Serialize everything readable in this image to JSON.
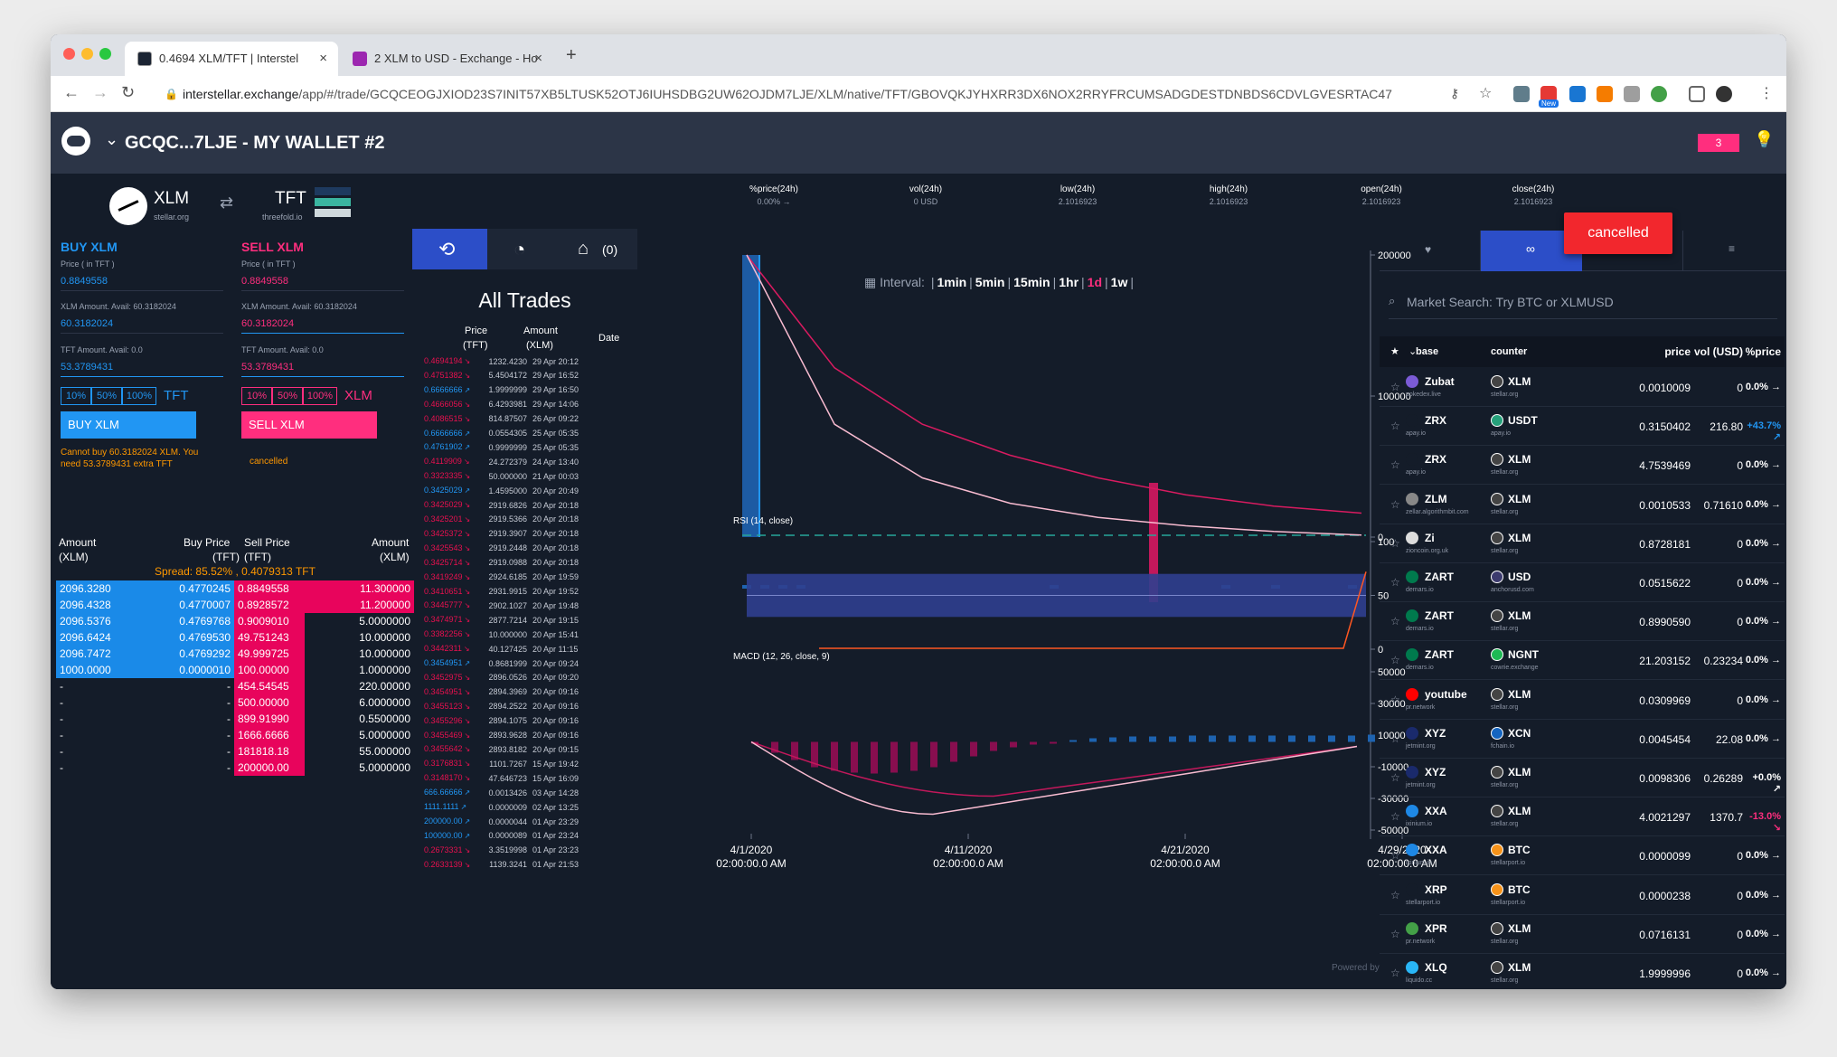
{
  "browser": {
    "tabs": [
      {
        "title": "0.4694 XLM/TFT | Interstel"
      },
      {
        "title": "2 XLM to USD - Exchange - Ho"
      }
    ],
    "url_host": "interstellar.exchange",
    "url_path": "/app/#/trade/GCQCEOGJXIOD23S7INIT57XB5LTUSK52OTJ6IUHSDBG2UW62OJDM7LJE/XLM/native/TFT/GBOVQKJYHXRR3DX6NOX2RRYFRCUMSADGDESTDNBDS6CDVLGVESRTAC47",
    "ext_badge": "New"
  },
  "header": {
    "wallet": "GCQC...7LJE - MY WALLET #2",
    "notif_count": "3"
  },
  "pair": {
    "base": "XLM",
    "base_domain": "stellar.org",
    "counter": "TFT",
    "counter_domain": "threefold.io",
    "swap_icon": "swap-arrows-icon"
  },
  "stats": [
    {
      "label": "%price(24h)",
      "value": "0.00% →"
    },
    {
      "label": "vol(24h)",
      "value": "0 USD"
    },
    {
      "label": "low(24h)",
      "value": "2.1016923"
    },
    {
      "label": "high(24h)",
      "value": "2.1016923"
    },
    {
      "label": "open(24h)",
      "value": "2.1016923"
    },
    {
      "label": "close(24h)",
      "value": "2.1016923"
    }
  ],
  "buy": {
    "title": "BUY XLM",
    "price_label": "Price ( in TFT )",
    "price": "0.8849558",
    "amount_label": "XLM Amount. Avail: 60.3182024",
    "amount": "60.3182024",
    "total_label": "TFT Amount. Avail: 0.0",
    "total": "53.3789431",
    "pcts": [
      "10%",
      "50%",
      "100%"
    ],
    "pct_unit": "TFT",
    "button": "BUY XLM",
    "error": "Cannot buy 60.3182024 XLM. You need 53.3789431 extra TFT"
  },
  "sell": {
    "title": "SELL XLM",
    "price_label": "Price ( in TFT )",
    "price": "0.8849558",
    "amount_label": "XLM Amount. Avail: 60.3182024",
    "amount": "60.3182024",
    "total_label": "TFT Amount. Avail: 0.0",
    "total": "53.3789431",
    "pcts": [
      "10%",
      "50%",
      "100%"
    ],
    "pct_unit": "XLM",
    "button": "SELL XLM",
    "status": "cancelled"
  },
  "orderbook": {
    "headers": {
      "amount_left": "Amount",
      "amount_left_unit": "(XLM)",
      "buy_price": "Buy Price",
      "buy_price_unit": "(TFT)",
      "sell_price": "Sell Price",
      "sell_price_unit": "(TFT)",
      "amount_right": "Amount",
      "amount_right_unit": "(XLM)"
    },
    "spread": "Spread: 85.52% , 0.4079313 TFT",
    "rows": [
      {
        "ba": "2096.3280",
        "bp": "0.4770245",
        "sp": "0.8849558",
        "sa": "11.300000"
      },
      {
        "ba": "2096.4328",
        "bp": "0.4770007",
        "sp": "0.8928572",
        "sa": "11.200000"
      },
      {
        "ba": "2096.5376",
        "bp": "0.4769768",
        "sp": "0.9009010",
        "sa": "5.0000000"
      },
      {
        "ba": "2096.6424",
        "bp": "0.4769530",
        "sp": "49.751243",
        "sa": "10.000000"
      },
      {
        "ba": "2096.7472",
        "bp": "0.4769292",
        "sp": "49.999725",
        "sa": "10.000000"
      },
      {
        "ba": "1000.0000",
        "bp": "0.0000010",
        "sp": "100.00000",
        "sa": "1.0000000"
      },
      {
        "ba": "-",
        "bp": "-",
        "sp": "454.54545",
        "sa": "220.00000"
      },
      {
        "ba": "-",
        "bp": "-",
        "sp": "500.00000",
        "sa": "6.0000000"
      },
      {
        "ba": "-",
        "bp": "-",
        "sp": "899.91990",
        "sa": "0.5500000"
      },
      {
        "ba": "-",
        "bp": "-",
        "sp": "1666.6666",
        "sa": "5.0000000"
      },
      {
        "ba": "-",
        "bp": "-",
        "sp": "181818.18",
        "sa": "55.000000"
      },
      {
        "ba": "-",
        "bp": "-",
        "sp": "200000.00",
        "sa": "5.0000000"
      }
    ]
  },
  "trades_panel": {
    "tab_icons": [
      "history-icon",
      "user-clock-icon",
      "basket-icon"
    ],
    "basket_count": "(0)",
    "title": "All Trades",
    "h_price": "Price",
    "h_price_unit": "(TFT)",
    "h_amount": "Amount",
    "h_amount_unit": "(XLM)",
    "h_date": "Date",
    "rows": [
      {
        "p": "0.4694194",
        "a": "1232.4230",
        "d": "29 Apr 20:12",
        "s": "sell"
      },
      {
        "p": "0.4751382",
        "a": "5.4504172",
        "d": "29 Apr 16:52",
        "s": "sell"
      },
      {
        "p": "0.6666666",
        "a": "1.9999999",
        "d": "29 Apr 16:50",
        "s": "buy"
      },
      {
        "p": "0.4666056",
        "a": "6.4293981",
        "d": "29 Apr 14:06",
        "s": "sell"
      },
      {
        "p": "0.4086515",
        "a": "814.87507",
        "d": "26 Apr 09:22",
        "s": "sell"
      },
      {
        "p": "0.6666666",
        "a": "0.0554305",
        "d": "25 Apr 05:35",
        "s": "buy"
      },
      {
        "p": "0.4761902",
        "a": "0.9999999",
        "d": "25 Apr 05:35",
        "s": "buy"
      },
      {
        "p": "0.4119909",
        "a": "24.272379",
        "d": "24 Apr 13:40",
        "s": "sell"
      },
      {
        "p": "0.3323335",
        "a": "50.000000",
        "d": "21 Apr 00:03",
        "s": "sell"
      },
      {
        "p": "0.3425029",
        "a": "1.4595000",
        "d": "20 Apr 20:49",
        "s": "buy"
      },
      {
        "p": "0.3425029",
        "a": "2919.6826",
        "d": "20 Apr 20:18",
        "s": "sell"
      },
      {
        "p": "0.3425201",
        "a": "2919.5366",
        "d": "20 Apr 20:18",
        "s": "sell"
      },
      {
        "p": "0.3425372",
        "a": "2919.3907",
        "d": "20 Apr 20:18",
        "s": "sell"
      },
      {
        "p": "0.3425543",
        "a": "2919.2448",
        "d": "20 Apr 20:18",
        "s": "sell"
      },
      {
        "p": "0.3425714",
        "a": "2919.0988",
        "d": "20 Apr 20:18",
        "s": "sell"
      },
      {
        "p": "0.3419249",
        "a": "2924.6185",
        "d": "20 Apr 19:59",
        "s": "sell"
      },
      {
        "p": "0.3410651",
        "a": "2931.9915",
        "d": "20 Apr 19:52",
        "s": "sell"
      },
      {
        "p": "0.3445777",
        "a": "2902.1027",
        "d": "20 Apr 19:48",
        "s": "sell"
      },
      {
        "p": "0.3474971",
        "a": "2877.7214",
        "d": "20 Apr 19:15",
        "s": "sell"
      },
      {
        "p": "0.3382256",
        "a": "10.000000",
        "d": "20 Apr 15:41",
        "s": "sell"
      },
      {
        "p": "0.3442311",
        "a": "40.127425",
        "d": "20 Apr 11:15",
        "s": "sell"
      },
      {
        "p": "0.3454951",
        "a": "0.8681999",
        "d": "20 Apr 09:24",
        "s": "buy"
      },
      {
        "p": "0.3452975",
        "a": "2896.0526",
        "d": "20 Apr 09:20",
        "s": "sell"
      },
      {
        "p": "0.3454951",
        "a": "2894.3969",
        "d": "20 Apr 09:16",
        "s": "sell"
      },
      {
        "p": "0.3455123",
        "a": "2894.2522",
        "d": "20 Apr 09:16",
        "s": "sell"
      },
      {
        "p": "0.3455296",
        "a": "2894.1075",
        "d": "20 Apr 09:16",
        "s": "sell"
      },
      {
        "p": "0.3455469",
        "a": "2893.9628",
        "d": "20 Apr 09:16",
        "s": "sell"
      },
      {
        "p": "0.3455642",
        "a": "2893.8182",
        "d": "20 Apr 09:15",
        "s": "sell"
      },
      {
        "p": "0.3176831",
        "a": "1101.7267",
        "d": "15 Apr 19:42",
        "s": "sell"
      },
      {
        "p": "0.3148170",
        "a": "47.646723",
        "d": "15 Apr 16:09",
        "s": "sell"
      },
      {
        "p": "666.66666",
        "a": "0.0013426",
        "d": "03 Apr 14:28",
        "s": "buy"
      },
      {
        "p": "1111.1111",
        "a": "0.0000009",
        "d": "02 Apr 13:25",
        "s": "buy"
      },
      {
        "p": "200000.00",
        "a": "0.0000044",
        "d": "01 Apr 23:29",
        "s": "buy"
      },
      {
        "p": "100000.00",
        "a": "0.0000089",
        "d": "01 Apr 23:24",
        "s": "buy"
      },
      {
        "p": "0.2673331",
        "a": "3.3519998",
        "d": "01 Apr 23:23",
        "s": "sell"
      },
      {
        "p": "0.2633139",
        "a": "1139.3241",
        "d": "01 Apr 21:53",
        "s": "sell"
      }
    ]
  },
  "chart_controls": {
    "interval_label": "Interval:",
    "intervals": [
      "1min",
      "5min",
      "15min",
      "1hr",
      "1d",
      "1w"
    ],
    "active": "1d"
  },
  "chart_data": [
    {
      "type": "line",
      "title": "",
      "x_ticks": [
        "4/1/2020",
        "4/11/2020",
        "4/21/2020",
        "4/29/2020"
      ],
      "x_tick_times": [
        "02:00:00.0 AM",
        "02:00:00.0 AM",
        "02:00:00.0 AM",
        "02:00:00.0 AM"
      ],
      "y_ticks": [
        200000,
        100000,
        0
      ],
      "ylim": [
        0,
        200000
      ],
      "series": [
        {
          "values": [
            200000,
            120000,
            80000,
            58000,
            42000,
            30000,
            22000,
            17000
          ]
        },
        {
          "values": [
            200000,
            80000,
            42000,
            24000,
            14000,
            8000,
            4000,
            1500
          ]
        }
      ],
      "volume_ticks": [
        50000,
        30000,
        10000,
        -10000,
        -30000,
        -50000
      ]
    },
    {
      "type": "line",
      "title": "RSI (14, close)",
      "y_ticks": [
        100,
        50,
        0
      ],
      "ylim": [
        0,
        100
      ],
      "band": [
        30,
        70
      ]
    },
    {
      "type": "bar",
      "title": "MACD (12, 26, close, 9)",
      "y_ticks": [
        50000,
        30000,
        10000,
        -10000,
        -30000,
        -50000
      ],
      "ylim": [
        -50000,
        50000
      ]
    }
  ],
  "chart_footer": "Powered by",
  "toast": "cancelled",
  "market": {
    "tab_icons": [
      "heart-icon",
      "infinity-icon",
      "star-icon",
      "list-icon"
    ],
    "search_placeholder": "Market Search: Try BTC or XLMUSD",
    "headers": {
      "star": "★",
      "base": "base",
      "counter": "counter",
      "price": "price",
      "vol": "vol (USD)",
      "pct": "%price"
    },
    "rows": [
      {
        "b": "Zubat",
        "bd": "pokedex.live",
        "c": "XLM",
        "cd": "stellar.org",
        "price": "0.0010009",
        "vol": "0",
        "pct": "0.0% →",
        "trend": "flat",
        "bc": "#7b5bd6",
        "cc": "#444"
      },
      {
        "b": "ZRX",
        "bd": "apay.io",
        "c": "USDT",
        "cd": "apay.io",
        "price": "0.3150402",
        "vol": "216.80",
        "pct": "+43.7% ↗",
        "trend": "up",
        "bc": "#141c29",
        "cc": "#26a17b"
      },
      {
        "b": "ZRX",
        "bd": "apay.io",
        "c": "XLM",
        "cd": "stellar.org",
        "price": "4.7539469",
        "vol": "0",
        "pct": "0.0% →",
        "trend": "flat",
        "bc": "#141c29",
        "cc": "#444"
      },
      {
        "b": "ZLM",
        "bd": "zellar.algorithmbit.com",
        "c": "XLM",
        "cd": "stellar.org",
        "price": "0.0010533",
        "vol": "0.71610",
        "pct": "0.0% →",
        "trend": "flat",
        "bc": "#888",
        "cc": "#444"
      },
      {
        "b": "Zi",
        "bd": "zioncoin.org.uk",
        "c": "XLM",
        "cd": "stellar.org",
        "price": "0.8728181",
        "vol": "0",
        "pct": "0.0% →",
        "trend": "flat",
        "bc": "#dddddd",
        "cc": "#444"
      },
      {
        "b": "ZART",
        "bd": "demars.io",
        "c": "USD",
        "cd": "anchorusd.com",
        "price": "0.0515622",
        "vol": "0",
        "pct": "0.0% →",
        "trend": "flat",
        "bc": "#007a4d",
        "cc": "#3c3b6e"
      },
      {
        "b": "ZART",
        "bd": "demars.io",
        "c": "XLM",
        "cd": "stellar.org",
        "price": "0.8990590",
        "vol": "0",
        "pct": "0.0% →",
        "trend": "flat",
        "bc": "#007a4d",
        "cc": "#444"
      },
      {
        "b": "ZART",
        "bd": "demars.io",
        "c": "NGNT",
        "cd": "cowrie.exchange",
        "price": "21.203152",
        "vol": "0.23234",
        "pct": "0.0% →",
        "trend": "flat",
        "bc": "#007a4d",
        "cc": "#1db954"
      },
      {
        "b": "youtube",
        "bd": "pr.network",
        "c": "XLM",
        "cd": "stellar.org",
        "price": "0.0309969",
        "vol": "0",
        "pct": "0.0% →",
        "trend": "flat",
        "bc": "#ff0000",
        "cc": "#444"
      },
      {
        "b": "XYZ",
        "bd": "jetmint.org",
        "c": "XCN",
        "cd": "fchain.io",
        "price": "0.0045454",
        "vol": "22.08",
        "pct": "0.0% →",
        "trend": "flat",
        "bc": "#1a2a6c",
        "cc": "#1565c0"
      },
      {
        "b": "XYZ",
        "bd": "jetmint.org",
        "c": "XLM",
        "cd": "stellar.org",
        "price": "0.0098306",
        "vol": "0.26289",
        "pct": "+0.0% ↗",
        "trend": "flat",
        "bc": "#1a2a6c",
        "cc": "#444"
      },
      {
        "b": "XXA",
        "bd": "ixinium.io",
        "c": "XLM",
        "cd": "stellar.org",
        "price": "4.0021297",
        "vol": "1370.7",
        "pct": "-13.0% ↘",
        "trend": "down",
        "bc": "#1e88e5",
        "cc": "#444"
      },
      {
        "b": "XXA",
        "bd": "ixinium.io",
        "c": "BTC",
        "cd": "stellarport.io",
        "price": "0.0000099",
        "vol": "0",
        "pct": "0.0% →",
        "trend": "flat",
        "bc": "#1e88e5",
        "cc": "#f7931a"
      },
      {
        "b": "XRP",
        "bd": "stellarport.io",
        "c": "BTC",
        "cd": "stellarport.io",
        "price": "0.0000238",
        "vol": "0",
        "pct": "0.0% →",
        "trend": "flat",
        "bc": "#141c29",
        "cc": "#f7931a"
      },
      {
        "b": "XPR",
        "bd": "pr.network",
        "c": "XLM",
        "cd": "stellar.org",
        "price": "0.0716131",
        "vol": "0",
        "pct": "0.0% →",
        "trend": "flat",
        "bc": "#43a047",
        "cc": "#444"
      },
      {
        "b": "XLQ",
        "bd": "liquido.cc",
        "c": "XLM",
        "cd": "stellar.org",
        "price": "1.9999996",
        "vol": "0",
        "pct": "0.0% →",
        "trend": "flat",
        "bc": "#29b6f6",
        "cc": "#444"
      }
    ]
  },
  "colors": {
    "buy": "#2196f3",
    "sell": "#ff2e7e",
    "toast": "#f2272d",
    "bg": "#141c29"
  }
}
